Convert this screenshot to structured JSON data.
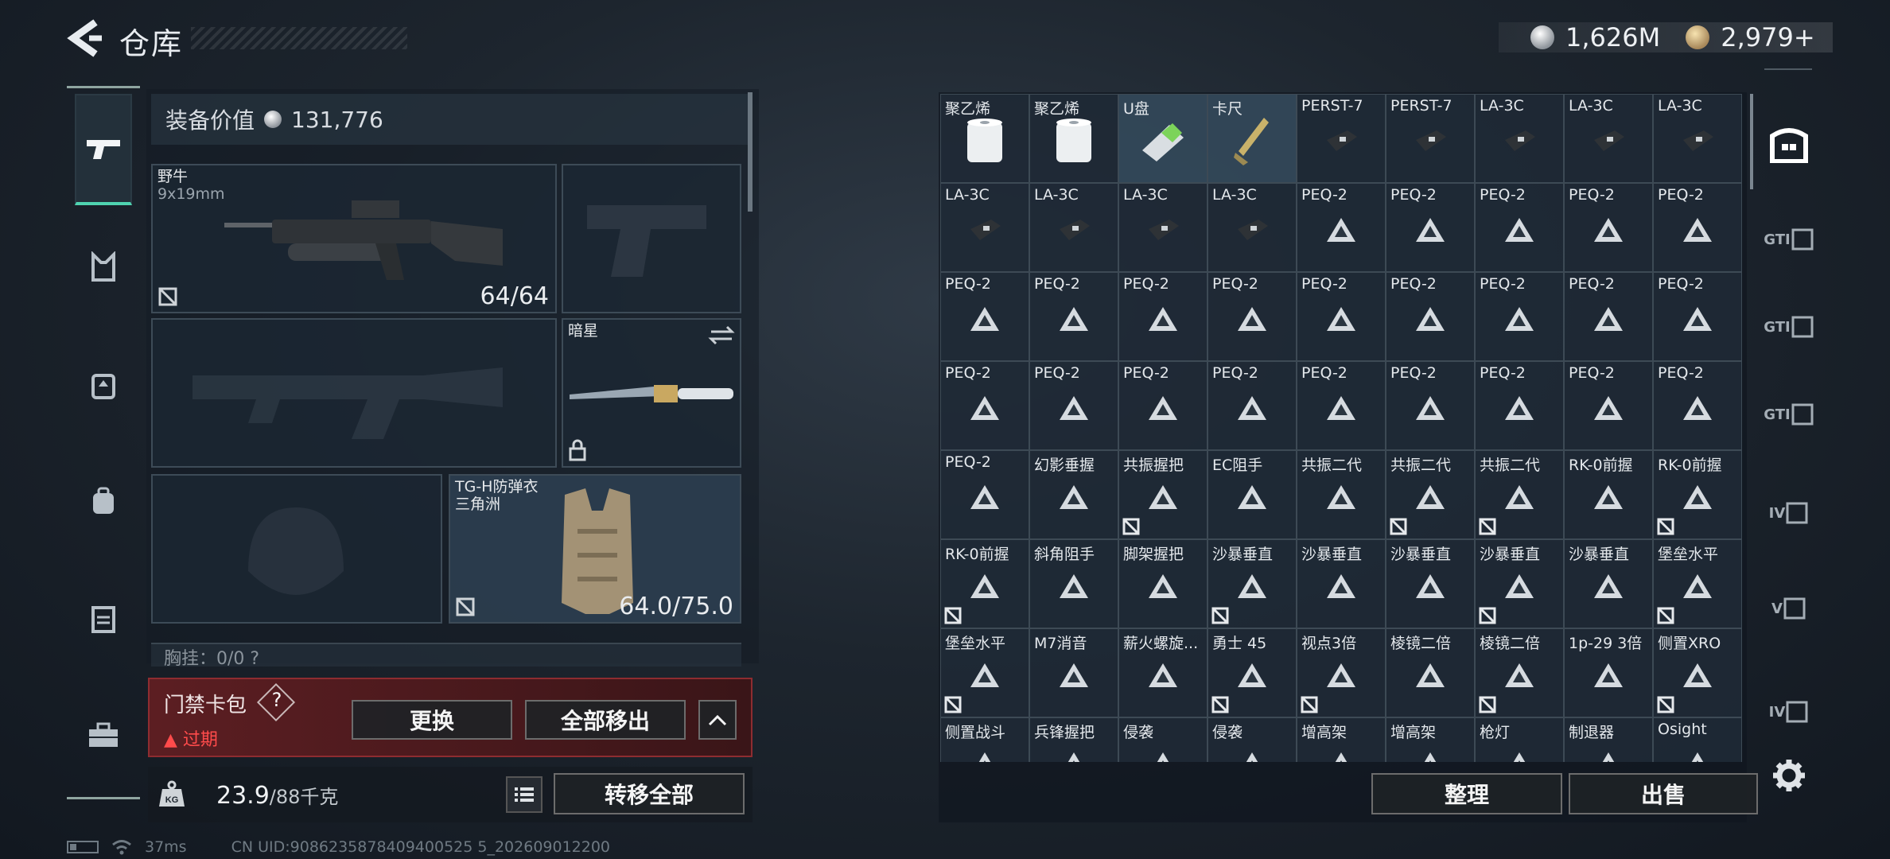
{
  "header": {
    "title": "仓库",
    "currencies": [
      {
        "icon": "silver-coin-icon",
        "value": "1,626M"
      },
      {
        "icon": "gold-coin-icon",
        "value": "2,979+"
      }
    ]
  },
  "equipment": {
    "value_label": "装备价值",
    "value": "131,776",
    "primary_weapon": {
      "name": "野牛",
      "caliber": "9x19mm",
      "ammo": "64/64"
    },
    "melee": {
      "name": "暗星"
    },
    "armor": {
      "name": "TG-H防弹衣",
      "faction": "三角洲",
      "durability": "64.0/75.0"
    },
    "partial_row": "胸挂：0/0  ?"
  },
  "access_card": {
    "title": "门禁卡包",
    "help": "?",
    "status": "过期",
    "swap_button": "更换",
    "take_all_button": "全部移出"
  },
  "weight": {
    "current": "23.9",
    "max": "/88千克",
    "transfer_all_button": "转移全部"
  },
  "footer": {
    "ping": "37ms",
    "uid": "CN UID:9086235878409400525 5_202609012200"
  },
  "grid": {
    "items": [
      {
        "name": "聚乙烯",
        "art": "spool"
      },
      {
        "name": "聚乙烯",
        "art": "spool"
      },
      {
        "name": "U盘",
        "art": "usb",
        "hl": true
      },
      {
        "name": "卡尺",
        "art": "caliper",
        "hl": true
      },
      {
        "name": "PERST-7",
        "art": "device"
      },
      {
        "name": "PERST-7",
        "art": "device"
      },
      {
        "name": "LA-3C",
        "art": "device"
      },
      {
        "name": "LA-3C",
        "art": "device"
      },
      {
        "name": "LA-3C",
        "art": "device"
      },
      {
        "name": "LA-3C",
        "art": "device"
      },
      {
        "name": "LA-3C",
        "art": "device"
      },
      {
        "name": "LA-3C",
        "art": "device"
      },
      {
        "name": "LA-3C",
        "art": "device"
      },
      {
        "name": "PEQ-2",
        "art": "tri"
      },
      {
        "name": "PEQ-2",
        "art": "tri"
      },
      {
        "name": "PEQ-2",
        "art": "tri"
      },
      {
        "name": "PEQ-2",
        "art": "tri"
      },
      {
        "name": "PEQ-2",
        "art": "tri"
      },
      {
        "name": "PEQ-2",
        "art": "tri"
      },
      {
        "name": "PEQ-2",
        "art": "tri"
      },
      {
        "name": "PEQ-2",
        "art": "tri"
      },
      {
        "name": "PEQ-2",
        "art": "tri"
      },
      {
        "name": "PEQ-2",
        "art": "tri"
      },
      {
        "name": "PEQ-2",
        "art": "tri"
      },
      {
        "name": "PEQ-2",
        "art": "tri"
      },
      {
        "name": "PEQ-2",
        "art": "tri"
      },
      {
        "name": "PEQ-2",
        "art": "tri"
      },
      {
        "name": "PEQ-2",
        "art": "tri"
      },
      {
        "name": "PEQ-2",
        "art": "tri"
      },
      {
        "name": "PEQ-2",
        "art": "tri"
      },
      {
        "name": "PEQ-2",
        "art": "tri"
      },
      {
        "name": "PEQ-2",
        "art": "tri"
      },
      {
        "name": "PEQ-2",
        "art": "tri"
      },
      {
        "name": "PEQ-2",
        "art": "tri"
      },
      {
        "name": "PEQ-2",
        "art": "tri"
      },
      {
        "name": "PEQ-2",
        "art": "tri"
      },
      {
        "name": "PEQ-2",
        "art": "tri"
      },
      {
        "name": "幻影垂握",
        "art": "tri"
      },
      {
        "name": "共振握把",
        "art": "tri",
        "mark": true
      },
      {
        "name": "EC阻手",
        "art": "tri"
      },
      {
        "name": "共振二代",
        "art": "tri"
      },
      {
        "name": "共振二代",
        "art": "tri",
        "mark": true
      },
      {
        "name": "共振二代",
        "art": "tri",
        "mark": true
      },
      {
        "name": "RK-0前握",
        "art": "tri"
      },
      {
        "name": "RK-0前握",
        "art": "tri",
        "mark": true
      },
      {
        "name": "RK-0前握",
        "art": "tri",
        "mark": true
      },
      {
        "name": "斜角阻手",
        "art": "tri"
      },
      {
        "name": "脚架握把",
        "art": "tri"
      },
      {
        "name": "沙暴垂直",
        "art": "tri",
        "mark": true
      },
      {
        "name": "沙暴垂直",
        "art": "tri"
      },
      {
        "name": "沙暴垂直",
        "art": "tri"
      },
      {
        "name": "沙暴垂直",
        "art": "tri",
        "mark": true
      },
      {
        "name": "沙暴垂直",
        "art": "tri"
      },
      {
        "name": "堡垒水平",
        "art": "tri",
        "mark": true
      },
      {
        "name": "堡垒水平",
        "art": "tri",
        "mark": true
      },
      {
        "name": "M7消音",
        "art": "tri"
      },
      {
        "name": "薪火螺旋...",
        "art": "tri"
      },
      {
        "name": "勇士 45",
        "art": "tri",
        "mark": true
      },
      {
        "name": "视点3倍",
        "art": "tri",
        "mark": true
      },
      {
        "name": "棱镜二倍",
        "art": "tri"
      },
      {
        "name": "棱镜二倍",
        "art": "tri",
        "mark": true
      },
      {
        "name": "1p-29 3倍",
        "art": "tri"
      },
      {
        "name": "侧置XRO",
        "art": "tri",
        "mark": true
      },
      {
        "name": "侧置战斗",
        "art": "tri"
      },
      {
        "name": "兵锋握把",
        "art": "tri"
      },
      {
        "name": "侵袭",
        "art": "tri"
      },
      {
        "name": "侵袭",
        "art": "tri"
      },
      {
        "name": "增高架",
        "art": "tri"
      },
      {
        "name": "增高架",
        "art": "tri"
      },
      {
        "name": "枪灯",
        "art": "tri"
      },
      {
        "name": "制退器",
        "art": "tri"
      },
      {
        "name": "Osight",
        "art": "tri"
      }
    ],
    "sort_button": "整理",
    "sell_button": "出售"
  },
  "right_rail": [
    "GTI",
    "GTI",
    "GTI",
    "IV",
    "V",
    "IV"
  ]
}
